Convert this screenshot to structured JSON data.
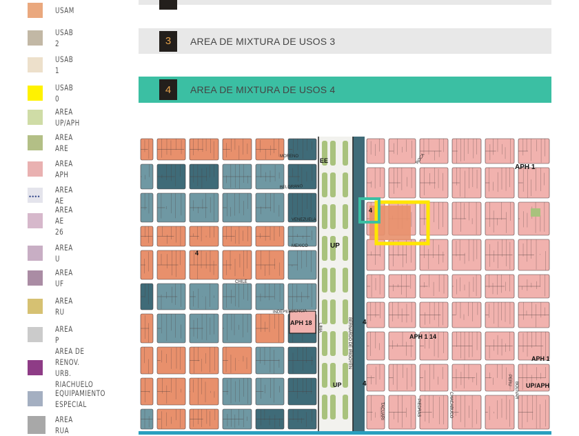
{
  "legend": [
    {
      "label": "USAM",
      "color": "#eaa87e"
    },
    {
      "label": "USAB 2",
      "color": "#c2b8a5"
    },
    {
      "label": "USAB 1",
      "color": "#ede0cb"
    },
    {
      "label": "USAB 0",
      "color": "#fff200"
    },
    {
      "label": "AREA UP/APH",
      "color": "#cfdca6"
    },
    {
      "label": "AREA ARE",
      "color": "#b3bf86"
    },
    {
      "label": "AREA APH",
      "color": "#e9b1b1"
    },
    {
      "label": "AREA AE",
      "color": "#e4e4ec",
      "dotted": true
    },
    {
      "label": "AREA AE 26",
      "color": "#d6b8cb"
    },
    {
      "label": "AREA U",
      "color": "#c8aec4"
    },
    {
      "label": "AREA UF",
      "color": "#aa8ca4"
    },
    {
      "label": "AREA RU",
      "color": "#d6c172"
    },
    {
      "label": "AREA P",
      "color": "#cbcbcb"
    },
    {
      "label": "AREA DE RENOV.\nURB. RIACHUELO",
      "color": "#8e3c86"
    },
    {
      "label": "EQUIPAMIENTO\nESPECIAL",
      "color": "#a4afc1"
    },
    {
      "label": "AREA RUA",
      "color": "#a8a8a8"
    }
  ],
  "bars": [
    {
      "number": "",
      "label": "",
      "color": "#e8e8e8"
    },
    {
      "number": "3",
      "label": "AREA DE MIXTURA DE USOS 3",
      "color": "#e8e8e8"
    },
    {
      "number": "4",
      "label": "AREA DE MIXTURA DE USOS 4",
      "color": "#3bbfa3"
    }
  ],
  "map": {
    "colors": {
      "usam": "#e8906c",
      "mixed": "#6f98a3",
      "mixed_dark": "#3f6b78",
      "aph": "#f1b2ae",
      "avenue": "#f2f2ee",
      "green": "#a9c27d",
      "street": "#ffffff",
      "highlight_yellow": "#ffe600",
      "highlight_teal": "#3bbfa3"
    },
    "street_labels": [
      "MORENO",
      "BELGRANO",
      "VENEZUELA",
      "MEXICO",
      "CHILE",
      "INDEPENDENCIA",
      "LIMA",
      "BERNARDO DE IRIGOYEN",
      "ROCA",
      "CHACABUCO",
      "PIEDRAS",
      "TACUARI",
      "PERU",
      "BOLIVAR"
    ],
    "zone_labels": [
      "EE",
      "UP",
      "UP",
      "4",
      "4",
      "4",
      "4",
      "APH 1",
      "APH 18",
      "APH 1 14",
      "APH 1",
      "UP/APH"
    ]
  }
}
